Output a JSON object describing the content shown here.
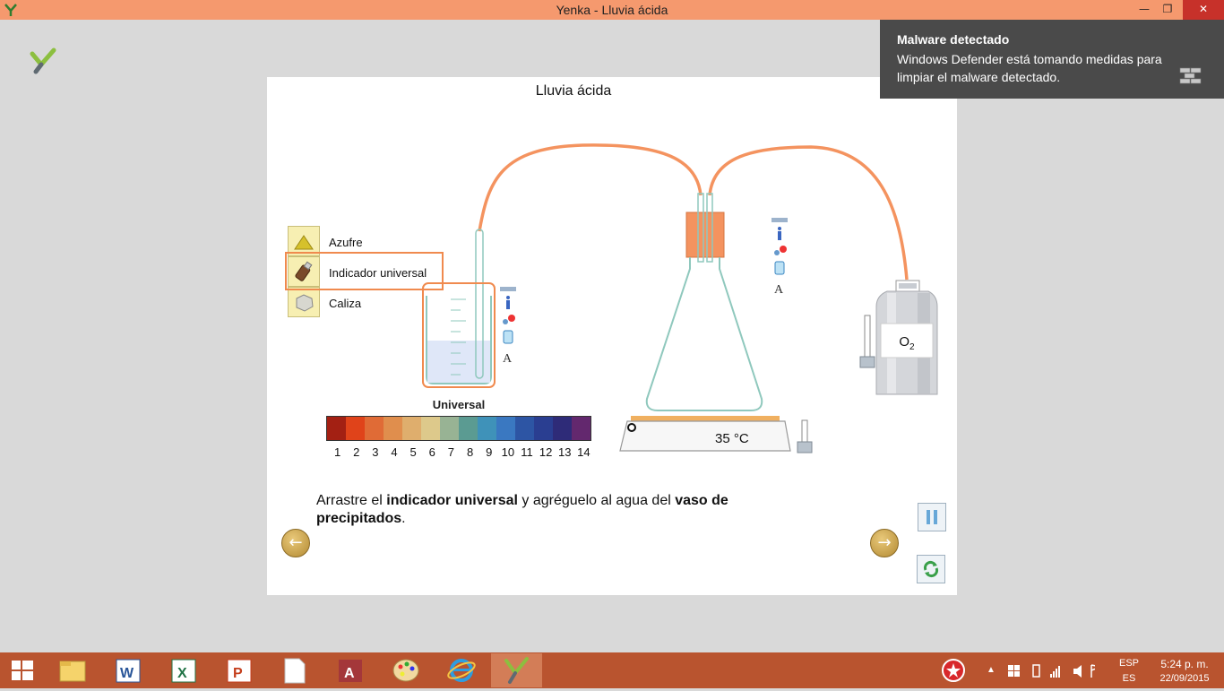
{
  "window": {
    "title": "Yenka - Lluvia ácida"
  },
  "sim": {
    "title": "Lluvia ácida",
    "chemicals": [
      {
        "label": "Azufre",
        "icon": "sulfur-pile-icon"
      },
      {
        "label": "Indicador universal",
        "icon": "indicator-bottle-icon"
      },
      {
        "label": "Caliza",
        "icon": "limestone-icon"
      }
    ],
    "scale_title": "Universal",
    "scale_ticks": [
      "1",
      "2",
      "3",
      "4",
      "5",
      "6",
      "7",
      "8",
      "9",
      "10",
      "11",
      "12",
      "13",
      "14"
    ],
    "scale_colors": [
      "#a32013",
      "#e0431a",
      "#e06b36",
      "#e08e4d",
      "#dfae6d",
      "#ddc98b",
      "#98b394",
      "#5b9b92",
      "#3f92b9",
      "#3a78c1",
      "#2d55a4",
      "#2a3e91",
      "#2e2b78",
      "#63286e"
    ],
    "hotplate_temp": "35 °C",
    "gas_label": "O",
    "gas_sub": "2",
    "instruction": {
      "p1": "Arrastre el ",
      "b1": "indicador universal",
      "p2": " y agréguelo al agua del ",
      "b2": "vaso de precipitados",
      "p3": "."
    }
  },
  "notification": {
    "title": "Malware detectado",
    "body": "Windows Defender está tomando medidas para limpiar el malware detectado."
  },
  "tray": {
    "lang_top": "ESP",
    "lang_bottom": "ES",
    "time": "5:24 p. m.",
    "date": "22/09/2015"
  },
  "colors": {
    "accent": "#f5996e",
    "taskbar": "#b9542f",
    "tube": "#f4935f",
    "glass": "#8fc8bd"
  }
}
